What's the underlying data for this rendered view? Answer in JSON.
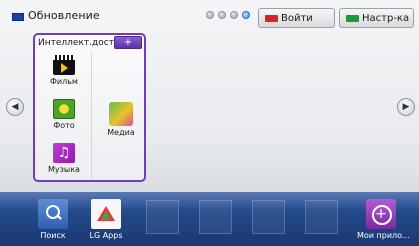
{
  "top_bar": {
    "update_label": "Обновление",
    "login_label": "Войти",
    "settings_label": "Настр-ка",
    "login_color": "#d8212b",
    "settings_color": "#1a9a3a",
    "page_indicator": {
      "total": 4,
      "active": 4
    }
  },
  "smart_access": {
    "title": "Интеллект.доступ",
    "add_label": "+",
    "items": [
      {
        "label": "Фильм",
        "icon": "film-icon"
      },
      {
        "label": "Фото",
        "icon": "photo-icon"
      },
      {
        "label": "Музыка",
        "icon": "music-icon"
      },
      {
        "label": "Медиа",
        "icon": "media-icon"
      }
    ]
  },
  "dock": {
    "items": [
      {
        "label": "Поиск",
        "icon": "search-icon"
      },
      {
        "label": "LG Apps",
        "icon": "lg-apps-icon"
      },
      {
        "label": "Мои прило...",
        "icon": "my-apps-icon"
      }
    ]
  },
  "colors": {
    "panel_border": "#6d3fb6",
    "dock": "#244a8c"
  }
}
